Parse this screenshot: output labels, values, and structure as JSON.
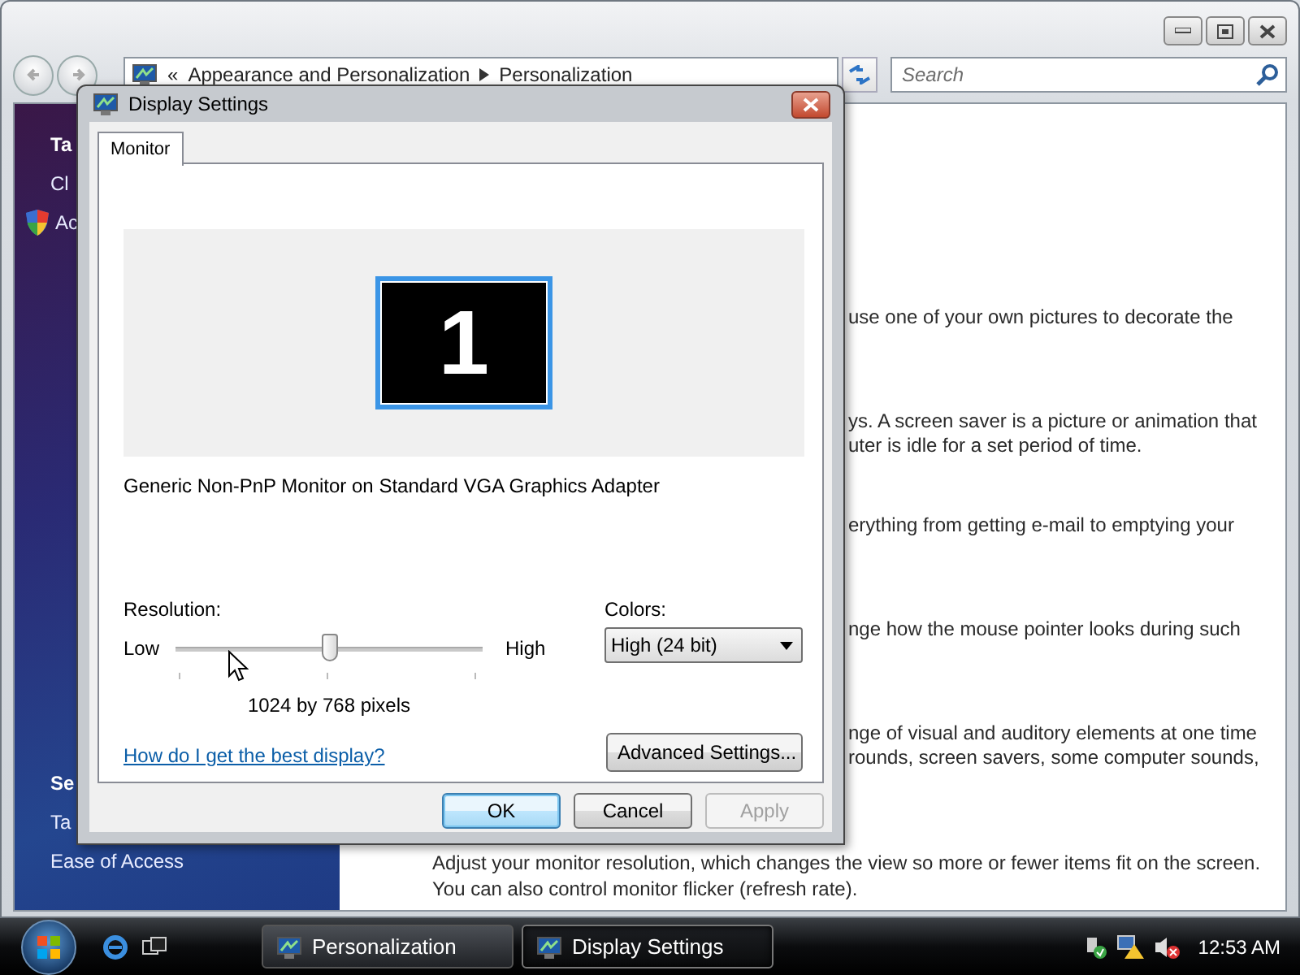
{
  "explorer": {
    "breadcrumb": {
      "overflow": "«",
      "items": [
        "Appearance and Personalization",
        "Personalization"
      ]
    },
    "search": {
      "placeholder": "Search"
    },
    "sidebar": {
      "top_items": [
        {
          "label": "Ta",
          "kind": "heading"
        },
        {
          "label": "Cl",
          "kind": "link"
        },
        {
          "label": "Ac",
          "kind": "shield"
        }
      ],
      "bottom_items": [
        {
          "label": "Se",
          "kind": "heading"
        },
        {
          "label": "Ta",
          "kind": "link"
        },
        {
          "label": "Ease of Access",
          "kind": "link"
        }
      ]
    },
    "content": {
      "paragraphs": [
        {
          "lines": [
            "use one of your own pictures to decorate the"
          ]
        },
        {
          "lines": [
            "ys. A screen saver is a picture or animation that",
            "uter is idle for a set period of time."
          ]
        },
        {
          "lines": [
            "erything from getting e-mail to emptying your"
          ]
        },
        {
          "lines": [
            "nge how the mouse pointer looks during such"
          ]
        },
        {
          "lines": [
            "nge of visual and auditory elements at one time",
            "rounds, screen savers, some computer sounds,"
          ]
        }
      ],
      "footer_lines": [
        "Adjust your monitor resolution, which changes the view so more or fewer items fit on the screen.",
        "You can also control monitor flicker (refresh rate)."
      ]
    }
  },
  "dialog": {
    "title": "Display Settings",
    "tabs": [
      {
        "label": "Monitor",
        "selected": true
      }
    ],
    "monitor_number": "1",
    "adapter": "Generic Non-PnP Monitor on Standard VGA Graphics Adapter",
    "resolution": {
      "label": "Resolution:",
      "low": "Low",
      "high": "High",
      "level": 0.5,
      "reading": "1024 by 768 pixels"
    },
    "colors": {
      "label": "Colors:",
      "value": "High (24 bit)"
    },
    "help_link": "How do I get the best display?",
    "advanced_button": "Advanced Settings...",
    "buttons": [
      {
        "label": "OK",
        "default": true,
        "disabled": false
      },
      {
        "label": "Cancel",
        "default": false,
        "disabled": false
      },
      {
        "label": "Apply",
        "default": false,
        "disabled": true
      }
    ]
  },
  "taskbar": {
    "tasks": [
      {
        "label": "Personalization",
        "selected": false
      },
      {
        "label": "Display Settings",
        "selected": true
      }
    ],
    "clock": "12:53 AM"
  }
}
